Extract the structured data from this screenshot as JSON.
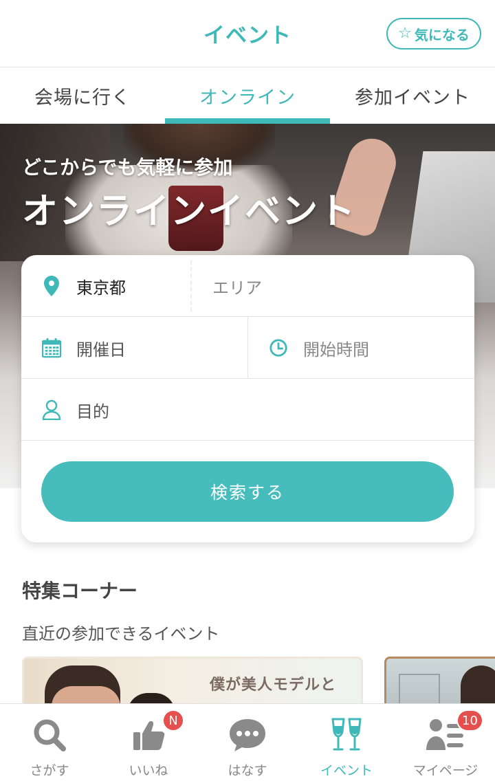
{
  "header": {
    "title": "イベント",
    "favorite_label": "気になる",
    "favorite_icon": "star-outline-icon"
  },
  "tabs": [
    {
      "label": "会場に行く",
      "active": false
    },
    {
      "label": "オンライン",
      "active": true
    },
    {
      "label": "参加イベント",
      "active": false
    }
  ],
  "hero": {
    "subtitle": "どこからでも気軽に参加",
    "title": "オンラインイベント"
  },
  "search": {
    "prefecture": "東京都",
    "area_placeholder": "エリア",
    "date_placeholder": "開催日",
    "time_placeholder": "開始時間",
    "purpose_placeholder": "目的",
    "button_label": "検索する"
  },
  "featured": {
    "title": "特集コーナー",
    "subtitle": "直近の参加できるイベント",
    "card1_text": "僕が美人モデルと"
  },
  "bottom_nav": [
    {
      "label": "さがす",
      "icon": "search-icon",
      "badge": ""
    },
    {
      "label": "いいね",
      "icon": "thumbs-up-icon",
      "badge": "N"
    },
    {
      "label": "はなす",
      "icon": "chat-icon",
      "badge": ""
    },
    {
      "label": "イベント",
      "icon": "champagne-glasses-icon",
      "badge": "",
      "active": true
    },
    {
      "label": "マイページ",
      "icon": "profile-list-icon",
      "badge": "10"
    }
  ],
  "colors": {
    "accent": "#3fb8b8",
    "button": "#47bcbc",
    "badge": "#e5504f"
  }
}
